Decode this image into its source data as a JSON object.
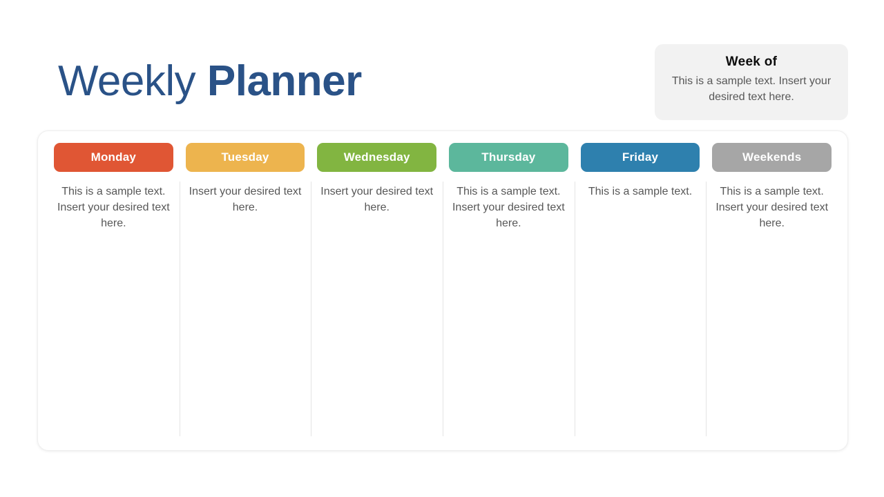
{
  "header": {
    "title_light": "Weekly",
    "title_bold": "Planner",
    "title_color": "#2a5287"
  },
  "week_of": {
    "title": "Week of",
    "body": "This is a sample text. Insert your desired text here.",
    "background": "#f2f2f2"
  },
  "planner": {
    "columns": [
      {
        "day": "Monday",
        "color": "#e05634",
        "note": "This is a sample text. Insert your desired text here."
      },
      {
        "day": "Tuesday",
        "color": "#edb44e",
        "note": "Insert your desired text here."
      },
      {
        "day": "Wednesday",
        "color": "#82b541",
        "note": "Insert your desired text here."
      },
      {
        "day": "Thursday",
        "color": "#5cb79c",
        "note": "This is a sample text. Insert your desired text here."
      },
      {
        "day": "Friday",
        "color": "#2e80ae",
        "note": "This is a sample text."
      },
      {
        "day": "Weekends",
        "color": "#a6a6a6",
        "note": "This is a sample text. Insert your desired text here."
      }
    ]
  }
}
